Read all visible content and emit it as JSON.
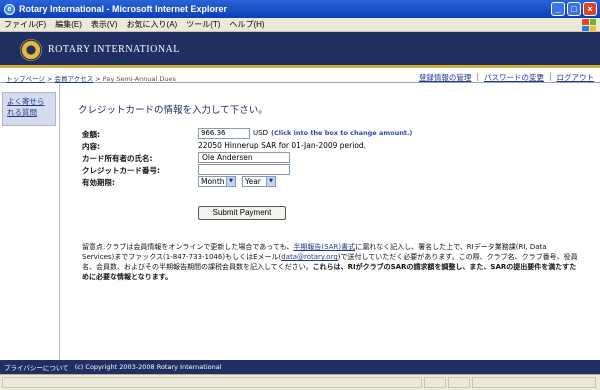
{
  "window": {
    "title": "Rotary International - Microsoft Internet Explorer",
    "buttons": [
      "_",
      "□",
      "×"
    ]
  },
  "menu": [
    "ファイル(F)",
    "編集(E)",
    "表示(V)",
    "お気に入り(A)",
    "ツール(T)",
    "ヘルプ(H)"
  ],
  "banner": {
    "title": "ROTARY INTERNATIONAL"
  },
  "breadcrumb": {
    "items": [
      "トップページ",
      "会員アクセス",
      "Pay Semi-Annual Dues"
    ],
    "separator": " > "
  },
  "toplinks": [
    "登録情報の管理",
    "パスワードの変更",
    "ログアウト"
  ],
  "sidebar": {
    "faq": "よく寄せられる質問"
  },
  "page": {
    "heading": "クレジットカードの情報を入力して下さい。"
  },
  "form": {
    "amount_label": "金額:",
    "amount_value": "966.36",
    "currency": "USD",
    "amount_hint": "(Click into the box to change amount.)",
    "content_label": "内容:",
    "content_value": "22050 Hinnerup SAR for 01-Jan-2009 period.",
    "cardholder_label": "カード所有者の氏名:",
    "cardholder_value": "Ole Andersen",
    "cardnumber_label": "クレジットカード番号:",
    "cardnumber_value": "",
    "expiry_label": "有効期限:",
    "month_value": "Month",
    "year_value": "Year",
    "submit_label": "Submit Payment"
  },
  "note": {
    "prefix": "留意点:",
    "p1": "クラブは会員情報をオンラインで更新した場合であっても、",
    "link1": "半期報告(SAR)書式",
    "p2": "に漏れなく記入し、署名した上で、RIデータ業務課(RI, Data Services)までファックス(1-847-733-1046)もしくはEメール(",
    "link2": "data@rotary.org",
    "p3": ")で送付していただく必要があります。この際、クラブ名、クラブ番号、役員名、会員数、およびその半期報告期間の課税会員数を記入してください。",
    "bold": "これらは、RIがクラブのSARの請求額を調整し、また、SARの提出要件を満たすために必要な情報となります。"
  },
  "footer": {
    "privacy": "プライバシーについて",
    "copyright": "(c) Copyright 2003-2008 Rotary International"
  },
  "colors": {
    "brand_navy": "#1f2f62",
    "gold": "#d2ad35",
    "link": "#223a8d"
  }
}
